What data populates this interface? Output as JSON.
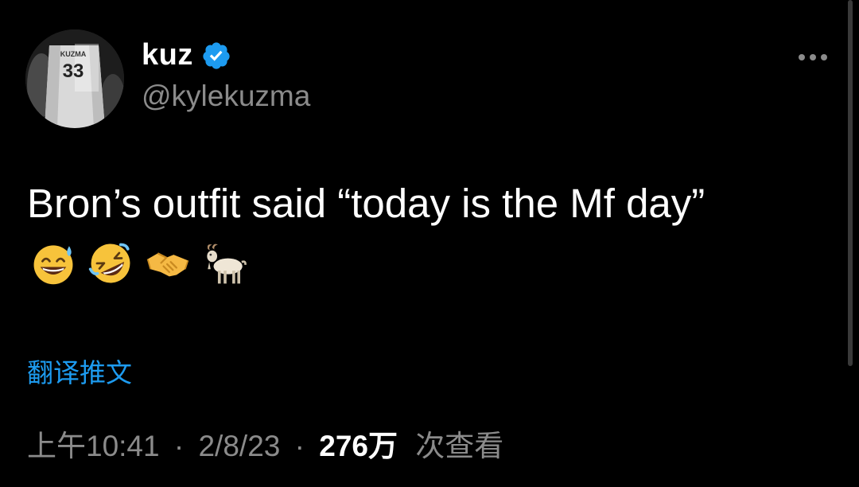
{
  "author": {
    "display_name": "kuz",
    "handle": "@kylekuzma",
    "avatar_jersey_name": "KUZMA",
    "avatar_jersey_number": "33",
    "verified": true
  },
  "icons": {
    "verified": "verified-badge-icon",
    "more": "more-options-icon",
    "emojis": [
      "grinning-face-with-sweat-icon",
      "rolling-on-floor-laughing-icon",
      "handshake-icon",
      "goat-icon"
    ]
  },
  "tweet": {
    "text": "Bron’s outfit said “today is the Mf day”"
  },
  "translate_label": "翻译推文",
  "meta": {
    "time": "上午10:41",
    "separator": "·",
    "date": "2/8/23",
    "views_count": "276万",
    "views_label": "次查看"
  },
  "colors": {
    "background": "#000000",
    "accent": "#1d9bf0",
    "secondary_text": "#8b8b8b"
  }
}
